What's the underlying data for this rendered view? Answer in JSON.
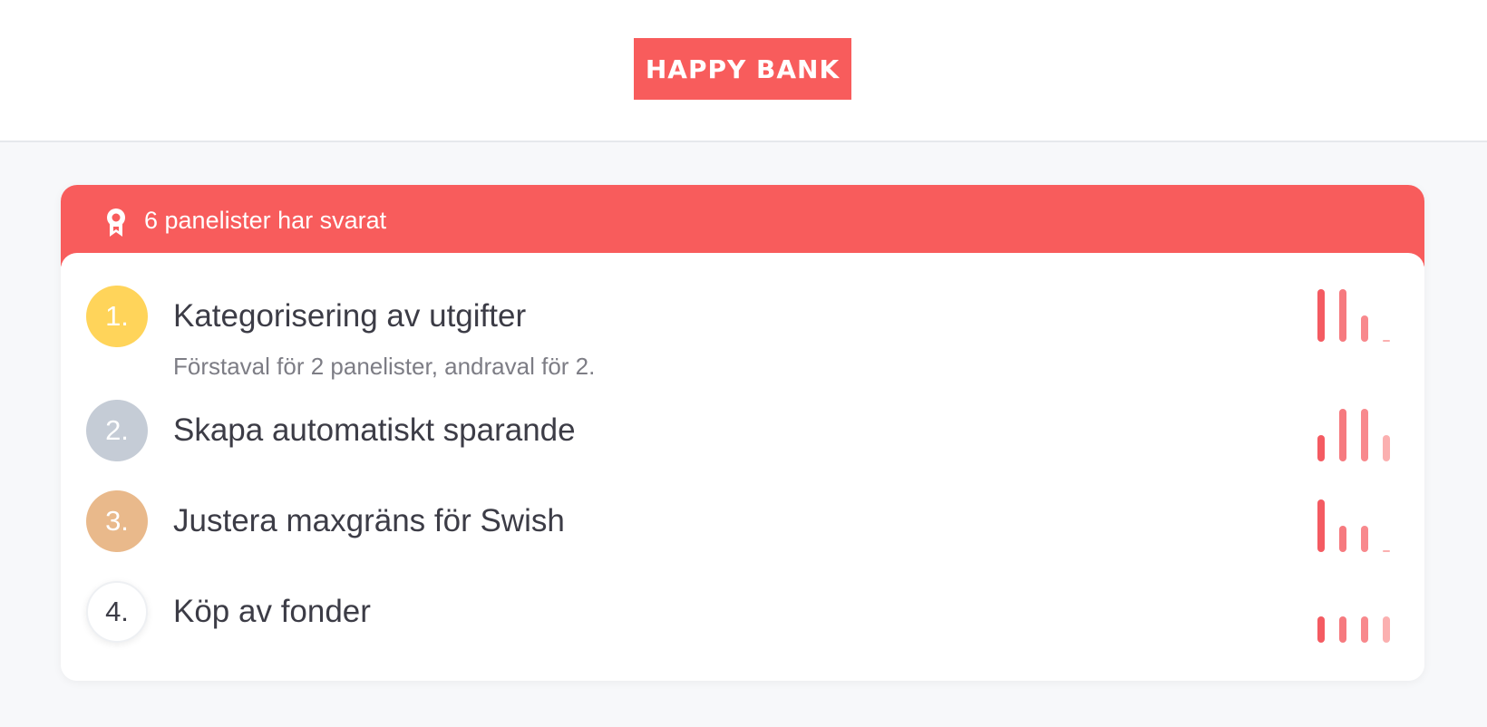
{
  "brand": {
    "name": "HAPPY BANK",
    "color": "#f85c5c"
  },
  "panel": {
    "icon": "award-icon",
    "respondents_text": "6 panelister har svarat"
  },
  "ranking": [
    {
      "rank_label": "1.",
      "circle_color": "#ffd45a",
      "title": "Kategorisering av utgifter",
      "subtitle": "Förstaval för 2 panelister, andraval för 2.",
      "distribution": [
        2,
        2,
        1,
        0
      ]
    },
    {
      "rank_label": "2.",
      "circle_color": "#c5ccd6",
      "title": "Skapa automatiskt sparande",
      "subtitle": "",
      "distribution": [
        1,
        2,
        2,
        1
      ]
    },
    {
      "rank_label": "3.",
      "circle_color": "#e9b98b",
      "title": "Justera maxgräns för Swish",
      "subtitle": "",
      "distribution": [
        2,
        1,
        1,
        0
      ]
    },
    {
      "rank_label": "4.",
      "circle_color": "#ffffff",
      "title": "Köp av fonder",
      "subtitle": "",
      "distribution": [
        1,
        1,
        1,
        1
      ]
    }
  ],
  "distribution_max": 2,
  "bar_colors": [
    "#f45b62",
    "#f67a7f",
    "#f8898d",
    "#fbb0b0"
  ]
}
